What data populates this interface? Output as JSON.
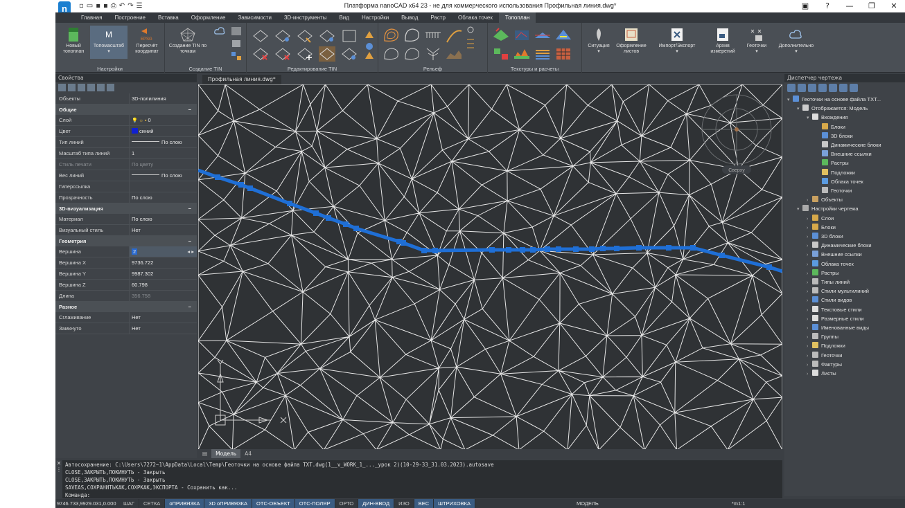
{
  "title": "Платформа nanoCAD x64 23 - не для коммерческого использования Профильная линия.dwg*",
  "tabs": [
    "Главная",
    "Построение",
    "Вставка",
    "Оформление",
    "Зависимости",
    "3D-инструменты",
    "Вид",
    "Настройки",
    "Вывод",
    "Растр",
    "Облака точек",
    "Топоплан"
  ],
  "ribbon": {
    "groups": [
      "Настройки",
      "Создание TIN",
      "Редактирование TIN",
      "Рельеф",
      "Текстуры и расчеты"
    ],
    "buttons": {
      "new_topoplan": "Новый топоплан",
      "topomasshtab": "Топомасштаб",
      "topomasshtab_icon_letter": "M",
      "recalc": "Пересчёт координат",
      "recalc_icon_label": "EPSG",
      "create_tin": "Создание TIN по точкам",
      "situation": "Ситуация",
      "sheet_layout": "Оформление листов",
      "import_export": "Импорт/Экспорт",
      "archive": "Архив измерений",
      "geopoints": "Геоточки",
      "more": "Дополнительно"
    }
  },
  "properties": {
    "header": "Свойства",
    "objects_label": "Объекты",
    "objects_value": "3D-полилиния",
    "sections": [
      {
        "name": "Общие",
        "rows": [
          {
            "k": "Слой",
            "v": "0"
          },
          {
            "k": "Цвет",
            "v": "синий"
          },
          {
            "k": "Тип линий",
            "v": "По слою"
          },
          {
            "k": "Масштаб типа линий",
            "v": "1"
          },
          {
            "k": "Стиль печати",
            "v": "По цвету"
          },
          {
            "k": "Вес линий",
            "v": "По слою"
          },
          {
            "k": "Гиперссылка",
            "v": ""
          },
          {
            "k": "Прозрачность",
            "v": "По слою"
          }
        ]
      },
      {
        "name": "3D-визуализация",
        "rows": [
          {
            "k": "Материал",
            "v": "По слою"
          },
          {
            "k": "Визуальный стиль",
            "v": "Нет"
          }
        ]
      },
      {
        "name": "Геометрия",
        "rows": [
          {
            "k": "Вершина",
            "v": "2"
          },
          {
            "k": "Вершина X",
            "v": "9736.722"
          },
          {
            "k": "Вершина Y",
            "v": "9987.302"
          },
          {
            "k": "Вершина Z",
            "v": "60.798"
          },
          {
            "k": "Длина",
            "v": "356.758"
          }
        ]
      },
      {
        "name": "Разное",
        "rows": [
          {
            "k": "Сглаживание",
            "v": "Нет"
          },
          {
            "k": "Замкнуто",
            "v": "Нет"
          }
        ]
      }
    ]
  },
  "document": {
    "tab": "Профильная линия.dwg*",
    "viewcube_label": "Сверху",
    "layout_tabs": [
      "Модель",
      "A4"
    ]
  },
  "drawing_manager": {
    "header": "Диспетчер чертежа",
    "items": [
      {
        "label": "Геоточки на основе файла TXT...",
        "level": 0,
        "color": "#5b8fd6"
      },
      {
        "label": "Отображается: Модель",
        "level": 1,
        "color": "#cccccc"
      },
      {
        "label": "Вхождения",
        "level": 2,
        "color": "#dddddd"
      },
      {
        "label": "Блоки",
        "level": 3,
        "color": "#d7a94a"
      },
      {
        "label": "3D блоки",
        "level": 3,
        "color": "#5b8fd6"
      },
      {
        "label": "Динамические блоки",
        "level": 3,
        "color": "#c8c8c8"
      },
      {
        "label": "Внешние ссылки",
        "level": 3,
        "color": "#7aa0d8"
      },
      {
        "label": "Растры",
        "level": 3,
        "color": "#5cb85c"
      },
      {
        "label": "Подложки",
        "level": 3,
        "color": "#e0c060"
      },
      {
        "label": "Облака точек",
        "level": 3,
        "color": "#5b9be0"
      },
      {
        "label": "Геоточки",
        "level": 3,
        "color": "#bbbbbb"
      },
      {
        "label": "Объекты",
        "level": 2,
        "color": "#c8a060"
      },
      {
        "label": "Настройки чертежа",
        "level": 1,
        "color": "#aaaaaa"
      },
      {
        "label": "Слои",
        "level": 2,
        "color": "#d7a94a"
      },
      {
        "label": "Блоки",
        "level": 2,
        "color": "#d7a94a"
      },
      {
        "label": "3D блоки",
        "level": 2,
        "color": "#5b8fd6"
      },
      {
        "label": "Динамические блоки",
        "level": 2,
        "color": "#c8c8c8"
      },
      {
        "label": "Внешние ссылки",
        "level": 2,
        "color": "#7aa0d8"
      },
      {
        "label": "Облака точек",
        "level": 2,
        "color": "#5b9be0"
      },
      {
        "label": "Растры",
        "level": 2,
        "color": "#5cb85c"
      },
      {
        "label": "Типы линий",
        "level": 2,
        "color": "#bbbbbb"
      },
      {
        "label": "Стили мультилиний",
        "level": 2,
        "color": "#bbbbbb"
      },
      {
        "label": "Стили видов",
        "level": 2,
        "color": "#5b8fd6"
      },
      {
        "label": "Текстовые стили",
        "level": 2,
        "color": "#dddddd"
      },
      {
        "label": "Размерные стили",
        "level": 2,
        "color": "#dddddd"
      },
      {
        "label": "Именованные виды",
        "level": 2,
        "color": "#5b8fd6"
      },
      {
        "label": "Группы",
        "level": 2,
        "color": "#bbbbbb"
      },
      {
        "label": "Подложки",
        "level": 2,
        "color": "#e0c060"
      },
      {
        "label": "Геоточки",
        "level": 2,
        "color": "#bbbbbb"
      },
      {
        "label": "Фактуры",
        "level": 2,
        "color": "#bbbbbb"
      },
      {
        "label": "Листы",
        "level": 2,
        "color": "#dddddd"
      }
    ]
  },
  "command_history": [
    "Автосохранение: C:\\Users\\7272~1\\AppData\\Local\\Temp\\Геоточки на основе файла TXT.dwg(1__v_WORK_1_..._урок 2)(10-29-33_31.03.2023).autosave",
    "CLOSE,ЗАКРЫТЬ,ПОКИНУТЬ - Закрыть",
    "CLOSE,ЗАКРЫТЬ,ПОКИНУТЬ - Закрыть",
    "SAVEAS,СОХРАНИТЬКАК,СОХРКАК,ЭКСПОРТА - Сохранить как..."
  ],
  "command_prompt": "Команда:",
  "status": {
    "coords": "9746.733,9929.031,0.000",
    "buttons": [
      {
        "label": "ШАГ",
        "on": false
      },
      {
        "label": "СЕТКА",
        "on": false
      },
      {
        "label": "оПРИВЯЗКА",
        "on": true
      },
      {
        "label": "3D оПРИВЯЗКА",
        "on": true
      },
      {
        "label": "ОТС-ОБЪЕКТ",
        "on": true
      },
      {
        "label": "ОТС-ПОЛЯР",
        "on": true
      },
      {
        "label": "ОРТО",
        "on": false
      },
      {
        "label": "ДИН-ВВОД",
        "on": true
      },
      {
        "label": "ИЗО",
        "on": false
      },
      {
        "label": "ВЕС",
        "on": true
      },
      {
        "label": "ШТРИХОВКА",
        "on": true
      }
    ],
    "model_label": "МОДЕЛЬ",
    "scale": "*m1:1"
  }
}
